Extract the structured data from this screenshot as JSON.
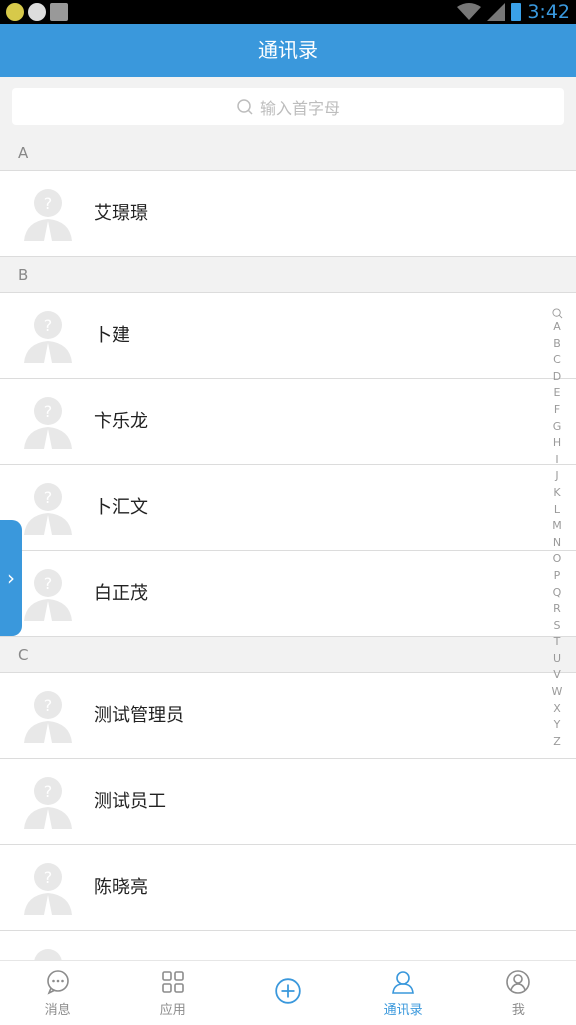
{
  "status": {
    "time": "3:42"
  },
  "header": {
    "title": "通讯录"
  },
  "search": {
    "placeholder": "输入首字母"
  },
  "sections": [
    {
      "letter": "A",
      "contacts": [
        "艾璟璟"
      ]
    },
    {
      "letter": "B",
      "contacts": [
        "卜建",
        "卞乐龙",
        "卜汇文",
        "白正茂"
      ]
    },
    {
      "letter": "C",
      "contacts": [
        "测试管理员",
        "测试员工",
        "陈晓亮"
      ]
    }
  ],
  "index_letters": [
    "A",
    "B",
    "C",
    "D",
    "E",
    "F",
    "G",
    "H",
    "I",
    "J",
    "K",
    "L",
    "M",
    "N",
    "O",
    "P",
    "Q",
    "R",
    "S",
    "T",
    "U",
    "V",
    "W",
    "X",
    "Y",
    "Z"
  ],
  "tabs": [
    {
      "label": "消息",
      "icon": "message-icon"
    },
    {
      "label": "应用",
      "icon": "apps-grid-icon"
    },
    {
      "label": "",
      "icon": "plus-circle-icon"
    },
    {
      "label": "通讯录",
      "icon": "contacts-icon"
    },
    {
      "label": "我",
      "icon": "profile-icon"
    }
  ],
  "colors": {
    "accent": "#3a98dc",
    "section_bg": "#f2f2f2"
  }
}
